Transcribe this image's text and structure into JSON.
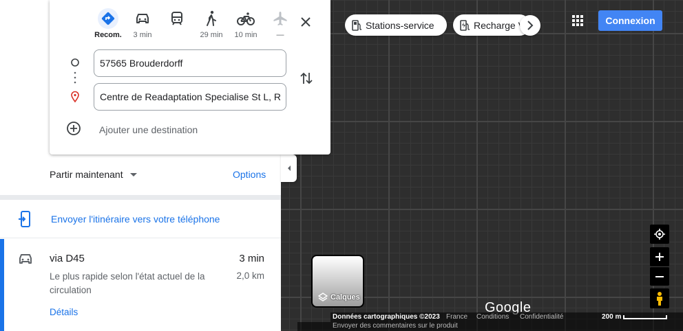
{
  "modes": [
    {
      "name": "recommended",
      "label": "Recom.",
      "active": true
    },
    {
      "name": "car",
      "label": "3 min"
    },
    {
      "name": "transit",
      "label": ""
    },
    {
      "name": "walk",
      "label": "29 min"
    },
    {
      "name": "bike",
      "label": "10 min"
    },
    {
      "name": "flight",
      "label": "—"
    }
  ],
  "origin": "57565 Brouderdorff",
  "destination": "Centre de Readaptation Specialise St L, R",
  "add_destination": "Ajouter une destination",
  "depart": "Partir maintenant",
  "options": "Options",
  "send_phone": "Envoyer l'itinéraire vers votre téléphone",
  "route": {
    "via": "via D45",
    "duration": "3 min",
    "description": "Le plus rapide selon l'état actuel de la circulation",
    "distance": "2,0 km",
    "details": "Détails"
  },
  "chips": [
    "Stations-service",
    "Recharge V"
  ],
  "login": "Connexion",
  "layers_label": "Calques",
  "google": "Google",
  "attribution": {
    "data": "Données cartographiques ©2023",
    "country": "France",
    "terms": "Conditions",
    "privacy": "Confidentialité",
    "scale": "200 m",
    "feedback": "Envoyer des commentaires sur le produit"
  },
  "colors": {
    "accent": "#1a73e8",
    "login": "#4285f4",
    "destination_pin": "#d93025"
  }
}
